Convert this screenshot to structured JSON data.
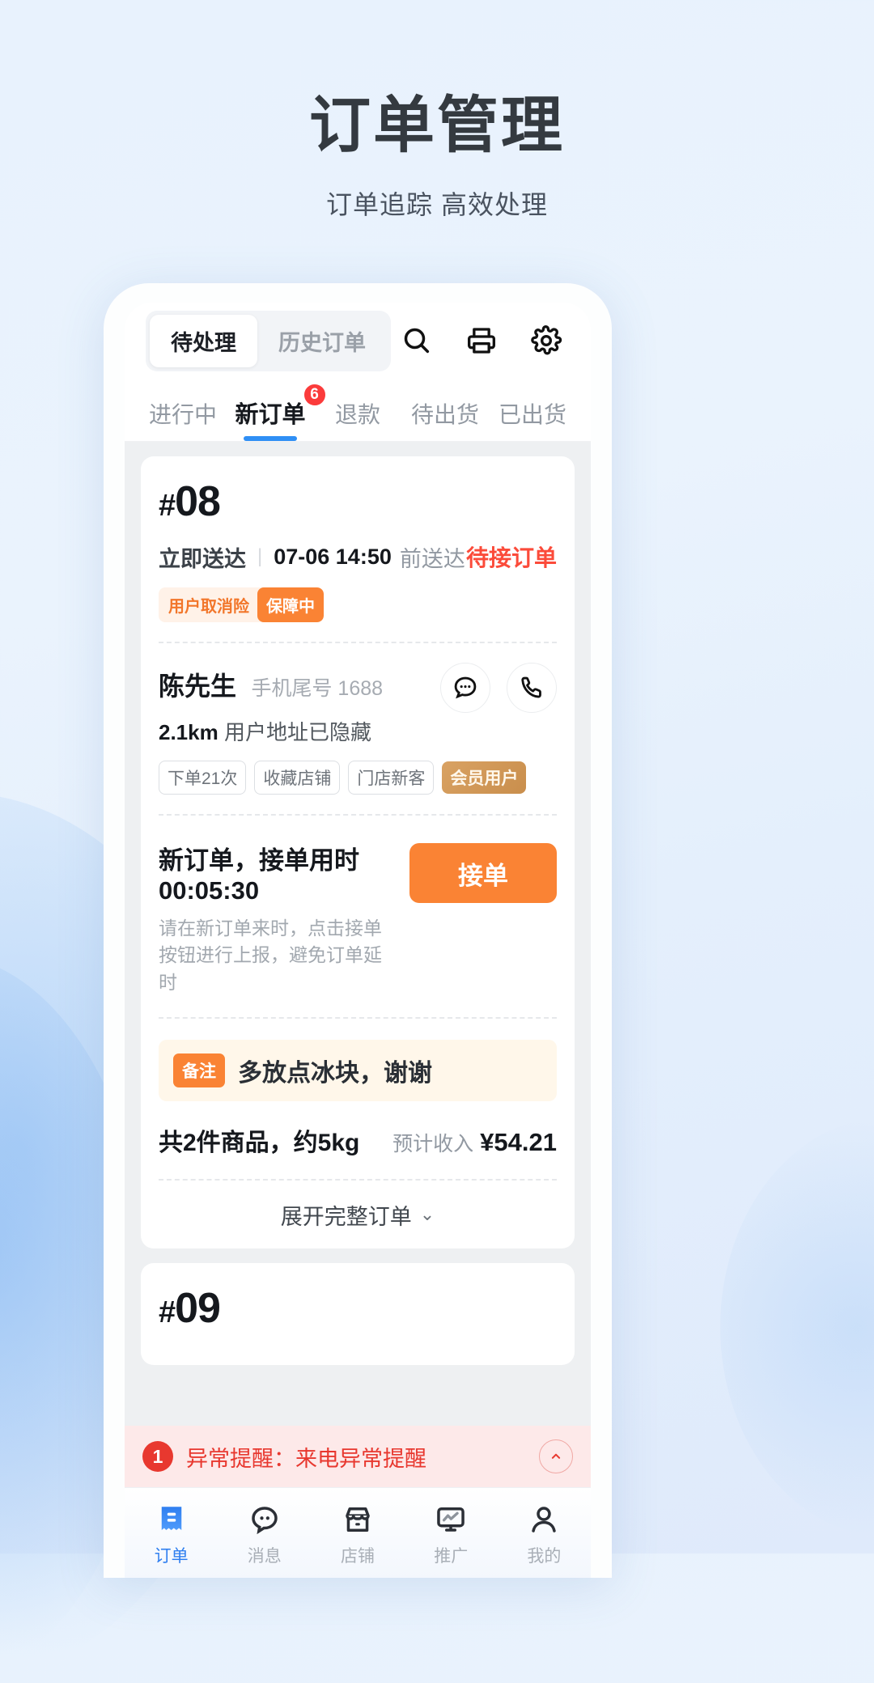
{
  "headline": {
    "title": "订单管理",
    "subtitle": "订单追踪 高效处理"
  },
  "topbar": {
    "segments": [
      {
        "label": "待处理",
        "active": true
      },
      {
        "label": "历史订单",
        "active": false
      }
    ],
    "icons": [
      {
        "name": "search-icon"
      },
      {
        "name": "printer-icon"
      },
      {
        "name": "gear-icon"
      }
    ]
  },
  "tabs": [
    {
      "label": "进行中",
      "active": false,
      "badge": ""
    },
    {
      "label": "新订单",
      "active": true,
      "badge": "6"
    },
    {
      "label": "退款",
      "active": false,
      "badge": ""
    },
    {
      "label": "待出货",
      "active": false,
      "badge": ""
    },
    {
      "label": "已出货",
      "active": false,
      "badge": ""
    }
  ],
  "order": {
    "number_hash": "#",
    "number": "08",
    "delivery_type": "立即送达",
    "separator": "|",
    "deliver_time": "07-06 14:50",
    "deliver_suffix": "前送达",
    "status": "待接订单",
    "insurance_label": "用户取消险",
    "insurance_state": "保障中",
    "customer": {
      "name": "陈先生",
      "phone_label": "手机尾号 1688",
      "distance": "2.1km",
      "address": "用户地址已隐藏",
      "tags": [
        {
          "label": "下单21次",
          "gold": false
        },
        {
          "label": "收藏店铺",
          "gold": false
        },
        {
          "label": "门店新客",
          "gold": false
        },
        {
          "label": "会员用户",
          "gold": true
        }
      ],
      "actions": [
        {
          "name": "message-icon"
        },
        {
          "name": "phone-icon"
        }
      ]
    },
    "accept": {
      "title": "新订单，接单用时 00:05:30",
      "desc": "请在新订单来时，点击接单按钮进行上报，避免订单延时",
      "button": "接单"
    },
    "remark": {
      "chip": "备注",
      "text": "多放点冰块，谢谢"
    },
    "totals": {
      "items": "共2件商品，约5kg",
      "income_label": "预计收入",
      "income_value": "¥54.21"
    },
    "expand": {
      "label": "展开完整订单",
      "chevron": "⌄"
    }
  },
  "order_next": {
    "number_hash": "#",
    "number": "09"
  },
  "alert": {
    "count": "1",
    "text": "异常提醒：来电异常提醒",
    "collapse_icon": "chevron-up-circle-icon"
  },
  "bottomnav": [
    {
      "label": "订单",
      "icon": "receipt-icon",
      "active": true
    },
    {
      "label": "消息",
      "icon": "chat-icon",
      "active": false
    },
    {
      "label": "店铺",
      "icon": "store-icon",
      "active": false
    },
    {
      "label": "推广",
      "icon": "monitor-chart-icon",
      "active": false
    },
    {
      "label": "我的",
      "icon": "person-icon",
      "active": false
    }
  ],
  "colors": {
    "accent_blue": "#2f8ff5",
    "orange": "#fa8334",
    "red": "#fb4b3a",
    "alert_red": "#e8382f",
    "gold": "#c98e4c"
  }
}
